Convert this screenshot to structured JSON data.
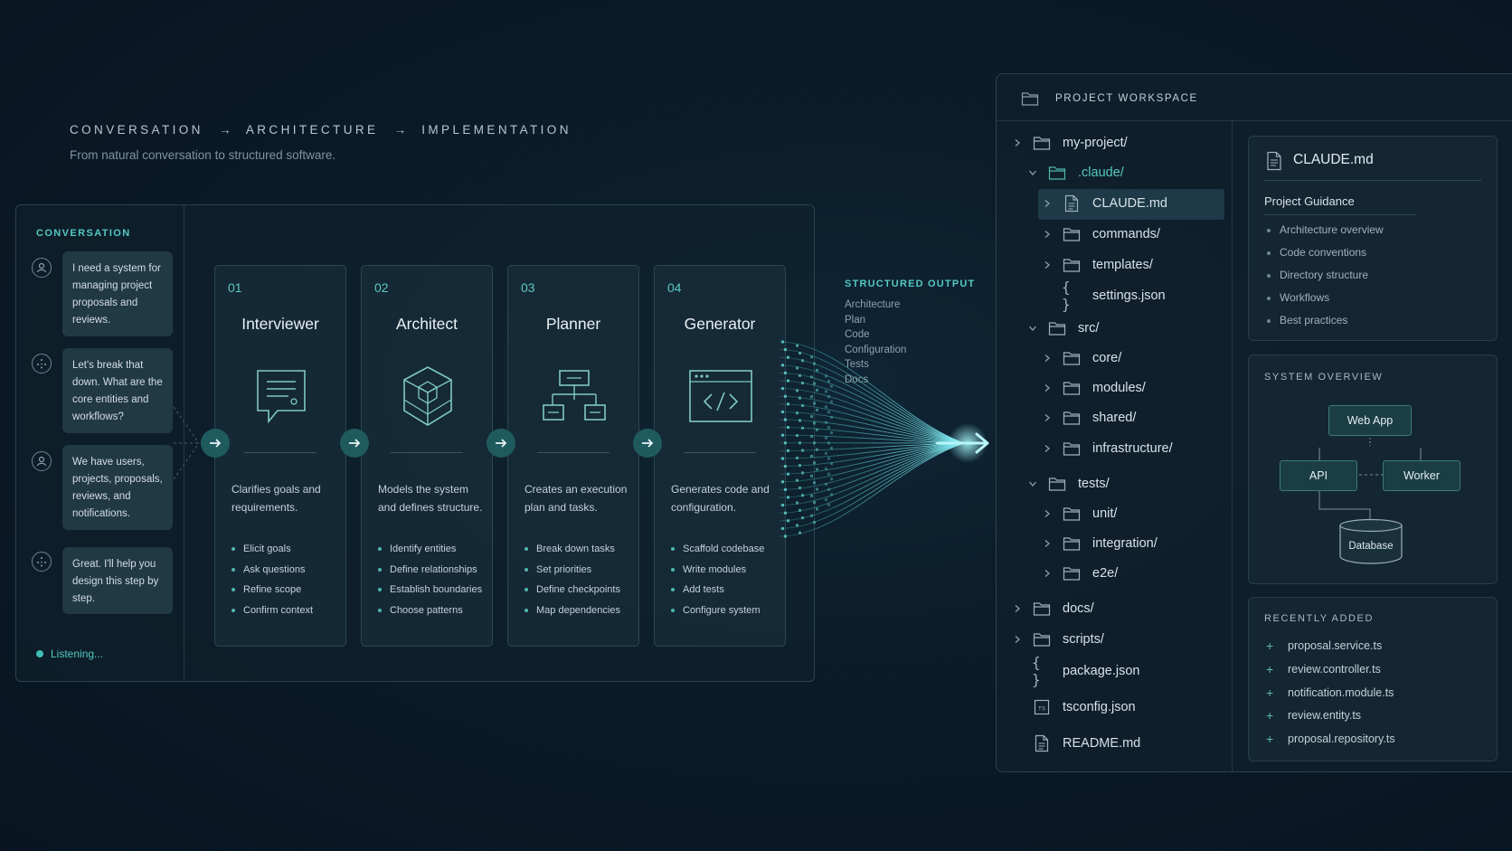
{
  "header": {
    "step1": "CONVERSATION",
    "arrow": "→",
    "step2": "ARCHITECTURE",
    "step3": "IMPLEMENTATION",
    "subtitle": "From natural conversation to structured software."
  },
  "conversation": {
    "label": "CONVERSATION",
    "messages": [
      {
        "role": "user",
        "text": "I need a system for managing project proposals and reviews."
      },
      {
        "role": "assistant",
        "text": "Let's break that down. What are the core entities and workflows?"
      },
      {
        "role": "user",
        "text": "We have users, projects, proposals, reviews, and notifications."
      },
      {
        "role": "assistant",
        "text": "Great. I'll help you design this step by step."
      }
    ],
    "status": "Listening..."
  },
  "pipeline": [
    {
      "num": "01",
      "title": "Interviewer",
      "icon": "chat-bubble-icon",
      "desc": "Clarifies goals and requirements.",
      "items": [
        "Elicit goals",
        "Ask questions",
        "Refine scope",
        "Confirm context"
      ]
    },
    {
      "num": "02",
      "title": "Architect",
      "icon": "cube-icon",
      "desc": "Models the system and defines structure.",
      "items": [
        "Identify entities",
        "Define relationships",
        "Establish boundaries",
        "Choose patterns"
      ]
    },
    {
      "num": "03",
      "title": "Planner",
      "icon": "hierarchy-icon",
      "desc": "Creates an execution plan and tasks.",
      "items": [
        "Break down tasks",
        "Set priorities",
        "Define checkpoints",
        "Map dependencies"
      ]
    },
    {
      "num": "04",
      "title": "Generator",
      "icon": "code-window-icon",
      "desc": "Generates code and configuration.",
      "items": [
        "Scaffold codebase",
        "Write modules",
        "Add tests",
        "Configure system"
      ]
    }
  ],
  "structured_output": {
    "title": "STRUCTURED OUTPUT",
    "items": [
      "Architecture",
      "Plan",
      "Code",
      "Configuration",
      "Tests",
      "Docs"
    ]
  },
  "workspace": {
    "title": "PROJECT WORKSPACE",
    "tree": [
      {
        "label": "my-project/",
        "depth": 0,
        "type": "folder",
        "chevron": "right"
      },
      {
        "label": ".claude/",
        "depth": 1,
        "type": "folder",
        "chevron": "down",
        "accent": true
      },
      {
        "label": "CLAUDE.md",
        "depth": 2,
        "type": "file",
        "chevron": "right",
        "selected": true
      },
      {
        "label": "commands/",
        "depth": 2,
        "type": "folder",
        "chevron": "right"
      },
      {
        "label": "templates/",
        "depth": 2,
        "type": "folder",
        "chevron": "right"
      },
      {
        "label": "settings.json",
        "depth": 2,
        "type": "json",
        "chevron": "none"
      },
      {
        "label": "src/",
        "depth": 1,
        "type": "folder",
        "chevron": "down"
      },
      {
        "label": "core/",
        "depth": 2,
        "type": "folder",
        "chevron": "right"
      },
      {
        "label": "modules/",
        "depth": 2,
        "type": "folder",
        "chevron": "right"
      },
      {
        "label": "shared/",
        "depth": 2,
        "type": "folder",
        "chevron": "right"
      },
      {
        "label": "infrastructure/",
        "depth": 2,
        "type": "folder",
        "chevron": "right"
      },
      {
        "label": "tests/",
        "depth": 1,
        "type": "folder",
        "chevron": "down"
      },
      {
        "label": "unit/",
        "depth": 2,
        "type": "folder",
        "chevron": "right"
      },
      {
        "label": "integration/",
        "depth": 2,
        "type": "folder",
        "chevron": "right"
      },
      {
        "label": "e2e/",
        "depth": 2,
        "type": "folder",
        "chevron": "right"
      },
      {
        "label": "docs/",
        "depth": 0,
        "type": "folder",
        "chevron": "right"
      },
      {
        "label": "scripts/",
        "depth": 0,
        "type": "folder",
        "chevron": "right"
      },
      {
        "label": "package.json",
        "depth": 0,
        "type": "json",
        "chevron": "none"
      },
      {
        "label": "tsconfig.json",
        "depth": 0,
        "type": "ts",
        "chevron": "none"
      },
      {
        "label": "README.md",
        "depth": 0,
        "type": "file",
        "chevron": "none"
      }
    ],
    "guidance": {
      "file": "CLAUDE.md",
      "heading": "Project Guidance",
      "items": [
        "Architecture overview",
        "Code conventions",
        "Directory structure",
        "Workflows",
        "Best practices"
      ]
    },
    "system_overview": {
      "label": "SYSTEM OVERVIEW",
      "nodes": {
        "web": "Web App",
        "api": "API",
        "worker": "Worker",
        "db": "Database"
      }
    },
    "recently_added": {
      "label": "RECENTLY ADDED",
      "items": [
        "proposal.service.ts",
        "review.controller.ts",
        "notification.module.ts",
        "review.entity.ts",
        "proposal.repository.ts"
      ]
    }
  },
  "colors": {
    "accent": "#55c8c2",
    "arrow_fill": "#1f5a5e",
    "selected": "#1e3a48"
  }
}
